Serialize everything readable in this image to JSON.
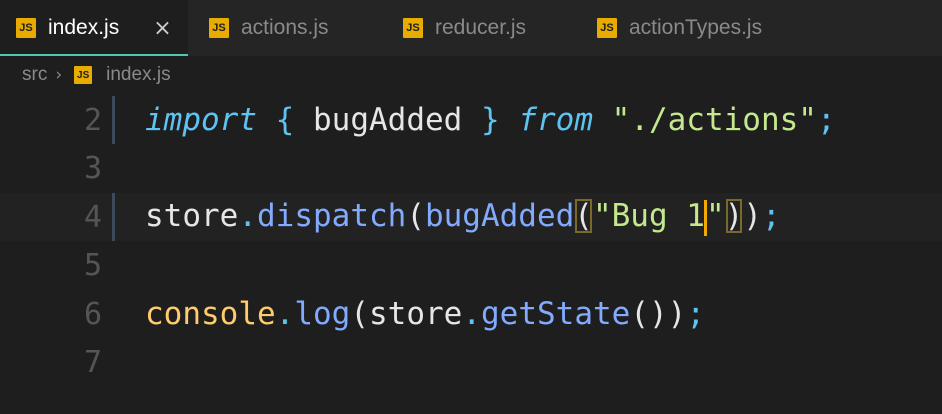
{
  "tabs": [
    {
      "label": "index.js",
      "badge": "JS",
      "active": true,
      "close": "×"
    },
    {
      "label": "actions.js",
      "badge": "JS",
      "active": false
    },
    {
      "label": "reducer.js",
      "badge": "JS",
      "active": false
    },
    {
      "label": "actionTypes.js",
      "badge": "JS",
      "active": false
    }
  ],
  "breadcrumb": {
    "folder": "src",
    "separator": "›",
    "badge": "JS",
    "file": "index.js"
  },
  "lines": [
    {
      "number": "2",
      "tokens": {
        "import": "import",
        "open": "{",
        "name": "bugAdded",
        "close": "}",
        "from": "from",
        "path": "\"./actions\"",
        "semi": ";"
      }
    },
    {
      "number": "3"
    },
    {
      "number": "4",
      "tokens": {
        "store": "store",
        "dot": ".",
        "dispatch": "dispatch",
        "p1": "(",
        "fn": "bugAdded",
        "p2": "(",
        "str1": "\"Bug 1",
        "str2": "\"",
        "p3": ")",
        "p4": ")",
        "semi": ";"
      }
    },
    {
      "number": "5"
    },
    {
      "number": "6",
      "tokens": {
        "console": "console",
        "dot1": ".",
        "log": "log",
        "p1": "(",
        "store": "store",
        "dot2": ".",
        "getState": "getState",
        "p2": "()",
        "p3": ")",
        "semi": ";"
      }
    },
    {
      "number": "7"
    }
  ],
  "colors": {
    "accent": "#4ec9b0",
    "cursor": "#f2a900",
    "js_badge": "#e8ab00"
  }
}
